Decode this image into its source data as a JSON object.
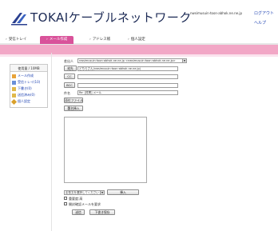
{
  "header": {
    "logo_text": "TOKAIケーブルネットワーク",
    "user_address": "nwsimusuin·toon·abhok.ne.ne.jp",
    "logout": "ログアウト",
    "help": "ヘルプ"
  },
  "tabs": [
    {
      "label": "受信トレイ"
    },
    {
      "label": "メール作成"
    },
    {
      "label": "アドレス帳"
    },
    {
      "label": "個人設定"
    }
  ],
  "sidebar": {
    "heading": "使用量 / 10MB",
    "items": [
      {
        "label": "メール作成"
      },
      {
        "label": "受信トレイ(10)"
      },
      {
        "label": "下書き(0)"
      },
      {
        "label": "送信済み(0)"
      },
      {
        "label": "個人設定"
      }
    ]
  },
  "compose": {
    "from_label": "差出人",
    "from_value": "nwsimusuin·toon·abhok.ne.ne.jp <nwsimusuin·toon·abhok.ne.ne.jp>",
    "to_button": "宛先",
    "to_value": "どちらさん(nwsimusuin·toon·abhok.ne.ne.jp)",
    "cc_button": "CC",
    "cc_value": "",
    "bcc_button": "BCC",
    "bcc_value": "",
    "subject_label": "件名",
    "subject_value": "Re: [質問] メール",
    "attach_button": "添付ファイル",
    "sign_button": "署名挿入",
    "body_value": "",
    "template_select": "定型文を選択してください",
    "insert_button": "挿入",
    "option_important": "重要度:高",
    "option_receipt": "開封確認メールを要求",
    "send_button": "送信",
    "draft_button": "下書き保存"
  }
}
